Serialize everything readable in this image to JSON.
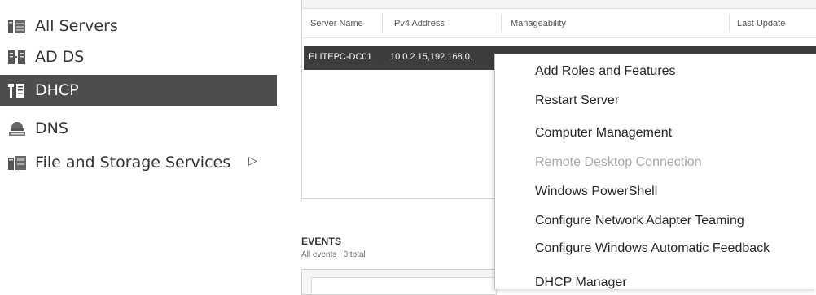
{
  "nav": {
    "items": [
      {
        "label": "All Servers",
        "icon": "all-servers-icon"
      },
      {
        "label": "AD DS",
        "icon": "ad-ds-icon"
      },
      {
        "label": "DHCP",
        "icon": "dhcp-icon",
        "active": true
      },
      {
        "label": "DNS",
        "icon": "dns-icon"
      },
      {
        "label": "File and Storage Services",
        "icon": "file-storage-icon",
        "has_submenu": true
      }
    ]
  },
  "servers": {
    "columns": [
      "Server Name",
      "IPv4 Address",
      "Manageability",
      "Last Update"
    ],
    "rows": [
      {
        "server_name": "ELITEPC-DC01",
        "ipv4": "10.0.2.15,192.168.0."
      }
    ]
  },
  "events": {
    "title": "EVENTS",
    "subtitle": "All events | 0 total"
  },
  "context_menu": {
    "items": [
      {
        "label": "Add Roles and Features",
        "enabled": true
      },
      {
        "label": "Restart Server",
        "enabled": true
      },
      {
        "label": "Computer Management",
        "enabled": true
      },
      {
        "label": "Remote Desktop Connection",
        "enabled": false
      },
      {
        "label": "Windows PowerShell",
        "enabled": true
      },
      {
        "label": "Configure Network Adapter Teaming",
        "enabled": true
      },
      {
        "label": "Configure Windows Automatic Feedback",
        "enabled": true
      },
      {
        "label": "DHCP Manager",
        "enabled": true
      }
    ]
  },
  "colors": {
    "nav_active_bg": "#4d4d4d",
    "selected_row_bg": "#3d3d3d",
    "disabled_text": "#a8a8a8"
  }
}
